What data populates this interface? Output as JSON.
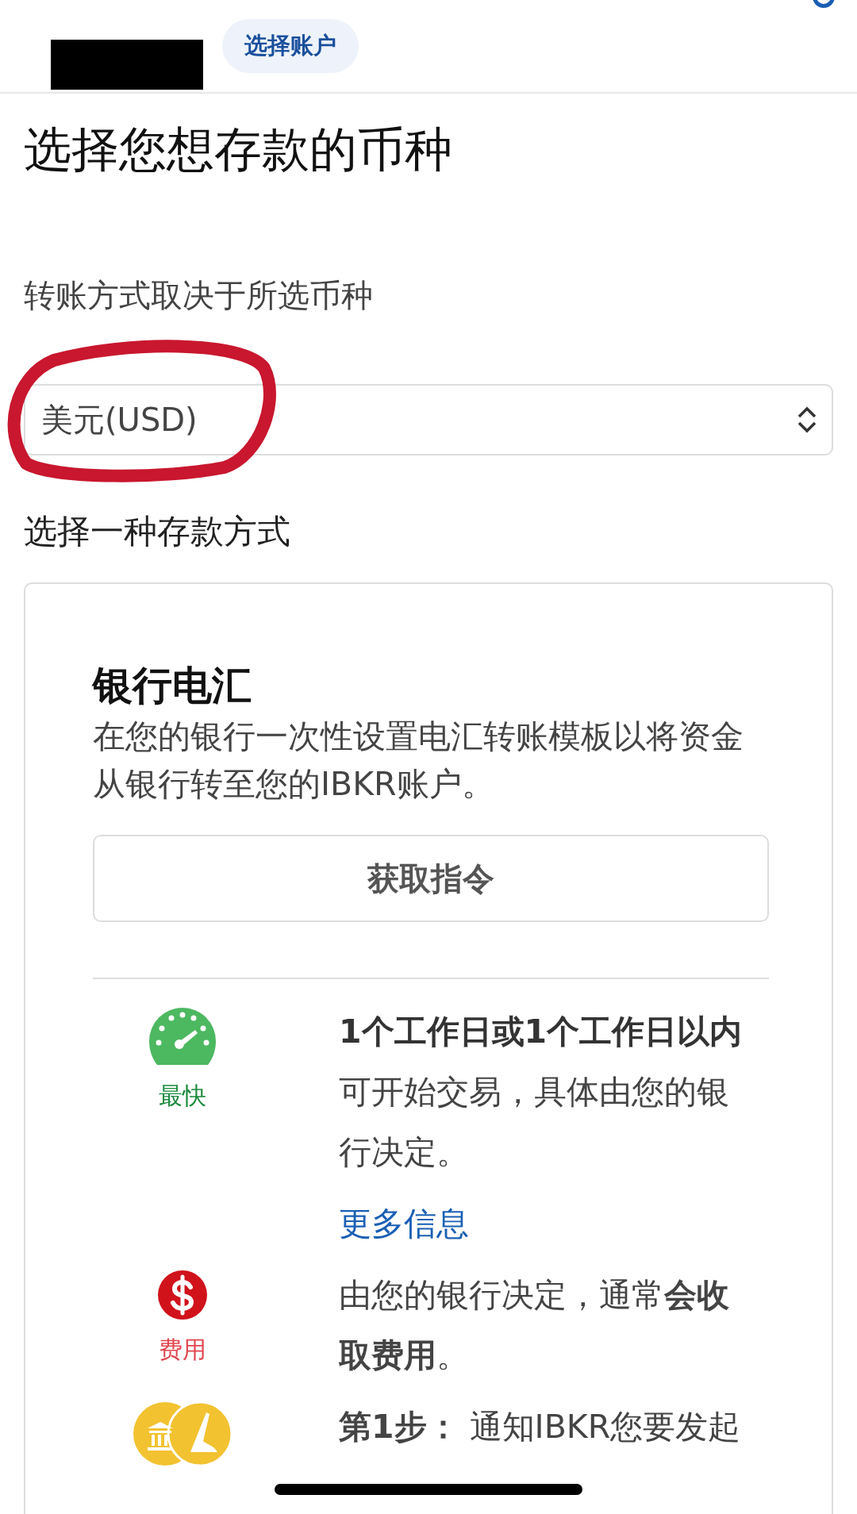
{
  "header": {
    "tabs": [
      {
        "label": "选择账户",
        "selected": true
      }
    ]
  },
  "title": "选择您想存款的币种",
  "currency": {
    "hint": "转账方式取决于所选币种",
    "value": "美元(USD)"
  },
  "methods_heading": "选择一种存款方式",
  "method": {
    "title": "银行电汇",
    "description": "在您的银行一次性设置电汇转账模板以将资金从银行转至您的IBKR账户。",
    "button": "获取指令",
    "features": [
      {
        "kind": "speed",
        "label": "最快",
        "color": "#1a8a3d",
        "heading": "1个工作日或1个工作日以内",
        "text": "可开始交易，具体由您的银行决定。",
        "link": "更多信息"
      },
      {
        "kind": "fee",
        "label": "费用",
        "color": "#e0464f",
        "text": "由您的银行决定，通常**会收取费用**。"
      },
      {
        "kind": "steps",
        "text": "**第1步：** 通知IBKR您要发起"
      }
    ]
  }
}
